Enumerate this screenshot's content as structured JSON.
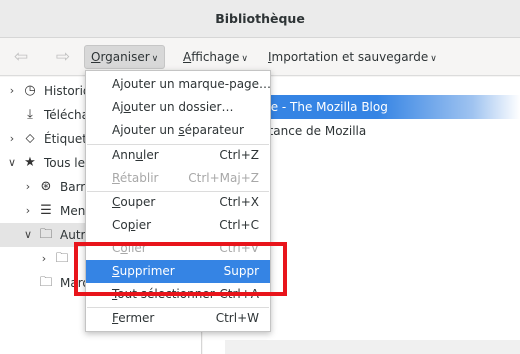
{
  "window": {
    "title": "Bibliothèque"
  },
  "toolbar": {
    "organize": {
      "mnemonic": "O",
      "rest": "rganiser"
    },
    "views": {
      "mnemonic": "A",
      "rest": "ffichage"
    },
    "import_backup": {
      "mnemonic": "I",
      "rest": "mportation et sauvegarde"
    }
  },
  "sidebar": {
    "items": [
      {
        "label": "Historique",
        "icon": "clock-icon"
      },
      {
        "label": "Téléchargements",
        "icon": "download-icon"
      },
      {
        "label": "Étiquettes",
        "icon": "tag-icon"
      },
      {
        "label": "Tous les marque-pages",
        "icon": "star-icon"
      },
      {
        "label": "Barre personnelle",
        "icon": "starred-folder-icon"
      },
      {
        "label": "Menu des marque-pages",
        "icon": "list-icon"
      },
      {
        "label": "Autres marque-pages",
        "icon": "folder-icon"
      },
      {
        "label": "",
        "icon": "folder-icon"
      },
      {
        "label": "Marque-pages",
        "icon": "folder-icon"
      }
    ]
  },
  "content": {
    "rows": [
      {
        "label": "me - The Mozilla Blog"
      },
      {
        "label": "istance de Mozilla"
      }
    ]
  },
  "context_menu": {
    "items": [
      {
        "pre": "A",
        "u": "j",
        "post": "outer un marque-page…",
        "shortcut": ""
      },
      {
        "pre": "Aj",
        "u": "o",
        "post": "uter un dossier…",
        "shortcut": ""
      },
      {
        "pre": "Ajouter un ",
        "u": "s",
        "post": "éparateur",
        "shortcut": ""
      },
      {
        "pre": "Ann",
        "u": "u",
        "post": "ler",
        "shortcut": "Ctrl+Z"
      },
      {
        "pre": "",
        "u": "R",
        "post": "établir",
        "shortcut": "Ctrl+Maj+Z"
      },
      {
        "pre": "",
        "u": "C",
        "post": "ouper",
        "shortcut": "Ctrl+X"
      },
      {
        "pre": "Co",
        "u": "p",
        "post": "ier",
        "shortcut": "Ctrl+C"
      },
      {
        "pre": "C",
        "u": "o",
        "post": "ller",
        "shortcut": "Ctrl+V"
      },
      {
        "pre": "",
        "u": "S",
        "post": "upprimer",
        "shortcut": "Suppr"
      },
      {
        "pre": "",
        "u": "T",
        "post": "out sélectionner",
        "shortcut": "Ctrl+A"
      },
      {
        "pre": "",
        "u": "F",
        "post": "ermer",
        "shortcut": "Ctrl+W"
      }
    ]
  }
}
